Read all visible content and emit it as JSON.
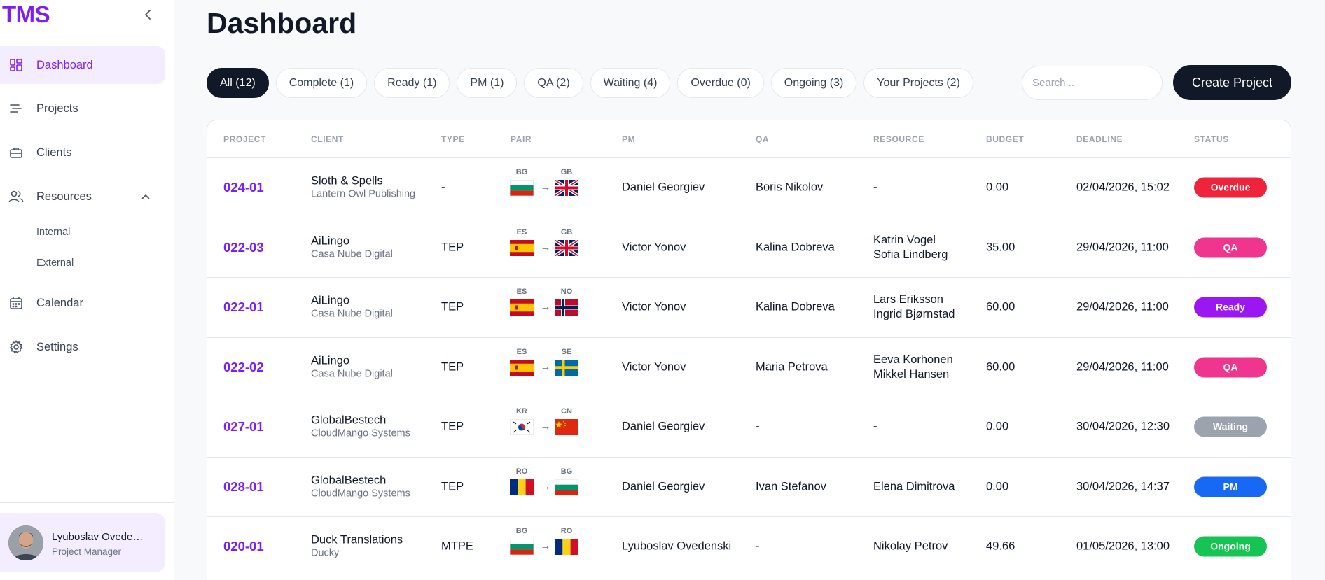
{
  "app": {
    "logo": "TMS",
    "page_title": "Dashboard"
  },
  "sidebar": {
    "items": [
      {
        "key": "dashboard",
        "label": "Dashboard",
        "icon": "dashboard-icon",
        "active": true
      },
      {
        "key": "projects",
        "label": "Projects",
        "icon": "projects-icon"
      },
      {
        "key": "clients",
        "label": "Clients",
        "icon": "briefcase-icon"
      },
      {
        "key": "resources",
        "label": "Resources",
        "icon": "users-icon",
        "expanded": true
      },
      {
        "key": "calendar",
        "label": "Calendar",
        "icon": "calendar-icon"
      },
      {
        "key": "settings",
        "label": "Settings",
        "icon": "gear-icon"
      }
    ],
    "resources_sub": [
      "Internal",
      "External"
    ],
    "user": {
      "name": "Lyuboslav Ovede…",
      "role": "Project Manager"
    }
  },
  "filters": [
    {
      "label": "All (12)",
      "active": true
    },
    {
      "label": "Complete (1)"
    },
    {
      "label": "Ready (1)"
    },
    {
      "label": "PM (1)"
    },
    {
      "label": "QA (2)"
    },
    {
      "label": "Waiting (4)"
    },
    {
      "label": "Overdue (0)"
    },
    {
      "label": "Ongoing (3)"
    },
    {
      "label": "Your Projects (2)"
    }
  ],
  "search": {
    "placeholder": "Search..."
  },
  "create_button": "Create Project",
  "table": {
    "headers": [
      "PROJECT",
      "CLIENT",
      "TYPE",
      "PAIR",
      "PM",
      "QA",
      "RESOURCE",
      "BUDGET",
      "DEADLINE",
      "STATUS"
    ],
    "rows": [
      {
        "project": "024-01",
        "client": "Sloth & Spells",
        "client_sub": "Lantern Owl Publishing",
        "type": "-",
        "src": "BG",
        "tgt": "GB",
        "pm": "Daniel Georgiev",
        "qa": "Boris Nikolov",
        "resource": "-",
        "budget": "0.00",
        "deadline": "02/04/2026, 15:02",
        "status": "Overdue",
        "status_color": "#ef233c"
      },
      {
        "project": "022-03",
        "client": "AiLingo",
        "client_sub": "Casa Nube Digital",
        "type": "TEP",
        "src": "ES",
        "tgt": "GB",
        "pm": "Victor Yonov",
        "qa": "Kalina Dobreva",
        "resource": "Katrin Vogel\nSofia Lindberg",
        "budget": "35.00",
        "deadline": "29/04/2026, 11:00",
        "status": "QA",
        "status_color": "#f0358f"
      },
      {
        "project": "022-01",
        "client": "AiLingo",
        "client_sub": "Casa Nube Digital",
        "type": "TEP",
        "src": "ES",
        "tgt": "NO",
        "pm": "Victor Yonov",
        "qa": "Kalina Dobreva",
        "resource": "Lars Eriksson\nIngrid Bjørnstad",
        "budget": "60.00",
        "deadline": "29/04/2026, 11:00",
        "status": "Ready",
        "status_color": "#9b16f0"
      },
      {
        "project": "022-02",
        "client": "AiLingo",
        "client_sub": "Casa Nube Digital",
        "type": "TEP",
        "src": "ES",
        "tgt": "SE",
        "pm": "Victor Yonov",
        "qa": "Maria Petrova",
        "resource": "Eeva Korhonen\nMikkel Hansen",
        "budget": "60.00",
        "deadline": "29/04/2026, 11:00",
        "status": "QA",
        "status_color": "#f0358f"
      },
      {
        "project": "027-01",
        "client": "GlobalBestech",
        "client_sub": "CloudMango Systems",
        "type": "TEP",
        "src": "KR",
        "tgt": "CN",
        "pm": "Daniel Georgiev",
        "qa": "-",
        "resource": "-",
        "budget": "0.00",
        "deadline": "30/04/2026, 12:30",
        "status": "Waiting",
        "status_color": "#9ca3af"
      },
      {
        "project": "028-01",
        "client": "GlobalBestech",
        "client_sub": "CloudMango Systems",
        "type": "TEP",
        "src": "RO",
        "tgt": "BG",
        "pm": "Daniel Georgiev",
        "qa": "Ivan Stefanov",
        "resource": "Elena Dimitrova",
        "budget": "0.00",
        "deadline": "30/04/2026, 14:37",
        "status": "PM",
        "status_color": "#1769f5"
      },
      {
        "project": "020-01",
        "client": "Duck Translations",
        "client_sub": "Ducky",
        "type": "MTPE",
        "src": "BG",
        "tgt": "RO",
        "pm": "Lyuboslav Ovedenski",
        "qa": "-",
        "resource": "Nikolay Petrov",
        "budget": "49.66",
        "deadline": "01/05/2026, 13:00",
        "status": "Ongoing",
        "status_color": "#16c453"
      }
    ]
  },
  "colors": {
    "accent": "#7c1ff5",
    "dark": "#111827"
  }
}
